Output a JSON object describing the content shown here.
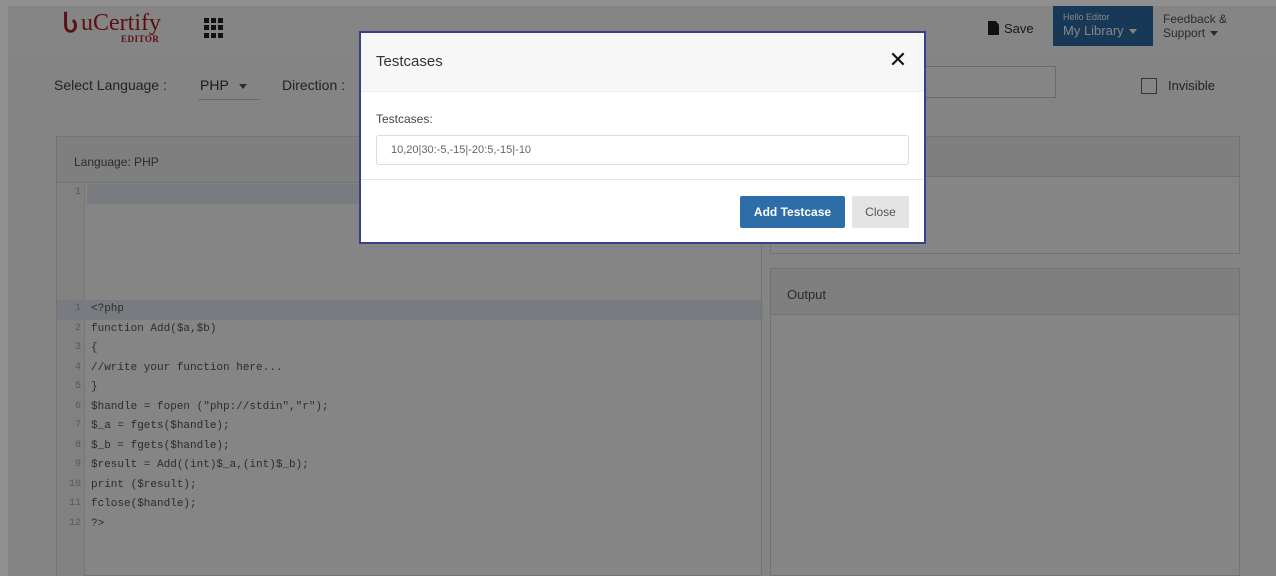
{
  "header": {
    "logo_mark": "Ⴑ",
    "logo_text": "uCertify",
    "logo_sub": "EDITOR",
    "save_label": "Save",
    "library_hello": "Hello Editor",
    "library_label": "My Library",
    "feedback_line1": "Feedback &",
    "feedback_line2": "Support"
  },
  "toolbar": {
    "language_label": "Select Language :",
    "language_value": "PHP",
    "direction_label": "Direction :",
    "invisible_label": "Invisible"
  },
  "editor": {
    "language_heading": "Language: PHP",
    "top_line_number": "1",
    "lines": [
      {
        "n": "1",
        "text": "<?php"
      },
      {
        "n": "2",
        "text": "function Add($a,$b)"
      },
      {
        "n": "3",
        "text": "{"
      },
      {
        "n": "4",
        "text": "//write your function here..."
      },
      {
        "n": "5",
        "text": "}"
      },
      {
        "n": "6",
        "text": "$handle = fopen (\"php://stdin\",\"r\");"
      },
      {
        "n": "7",
        "text": "$_a = fgets($handle);"
      },
      {
        "n": "8",
        "text": "$_b = fgets($handle);"
      },
      {
        "n": "9",
        "text": "$result = Add((int)$_a,(int)$_b);"
      },
      {
        "n": "10",
        "text": "print ($result);"
      },
      {
        "n": "11",
        "text": "fclose($handle);"
      },
      {
        "n": "12",
        "text": "?>"
      }
    ]
  },
  "output": {
    "heading": "Output"
  },
  "modal": {
    "title": "Testcases",
    "close_glyph": "✕",
    "field_label": "Testcases:",
    "field_value": "10,20|30:-5,-15|-20:5,-15|-10",
    "add_label": "Add Testcase",
    "close_label": "Close"
  },
  "colors": {
    "brand": "#b01e23",
    "primary": "#2d6ea8",
    "modal_border": "#3b3f8a"
  }
}
